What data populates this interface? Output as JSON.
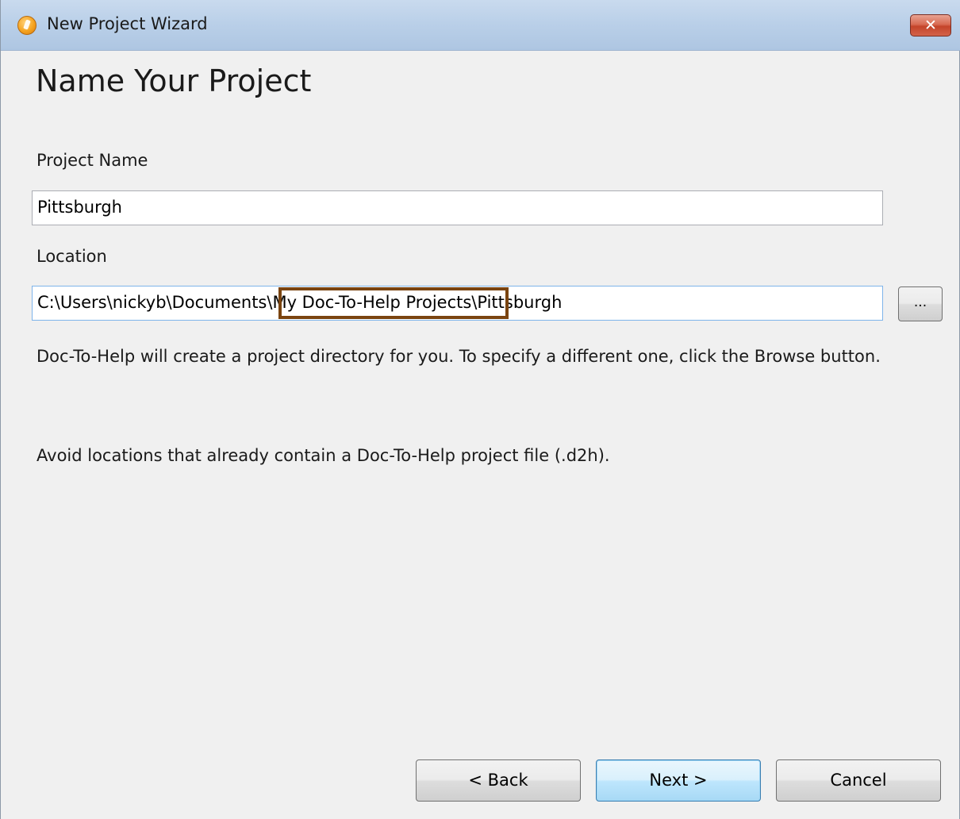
{
  "window": {
    "title": "New Project Wizard",
    "close_glyph": "✕"
  },
  "page": {
    "heading": "Name Your Project"
  },
  "project_name": {
    "label": "Project Name",
    "value": "Pittsburgh"
  },
  "location": {
    "label": "Location",
    "value_prefix": "C:\\Users\\nickyb\\Documents\\",
    "value_highlight": "My Doc-To-Help Projects\\",
    "value_suffix": "Pittsburgh",
    "browse_label": "..."
  },
  "info": {
    "line1": "Doc-To-Help will create a project directory for you. To specify a different one, click the Browse button.",
    "line2": "Avoid locations that already contain a Doc-To-Help project file (.d2h)."
  },
  "buttons": {
    "back": "< Back",
    "next": "Next >",
    "cancel": "Cancel"
  },
  "colors": {
    "highlight_border": "#7a4410",
    "titlebar": "#b9cfe8",
    "close_button": "#c4442a"
  },
  "icons": {
    "app": "doc-to-help-app-icon",
    "close": "close-icon"
  }
}
